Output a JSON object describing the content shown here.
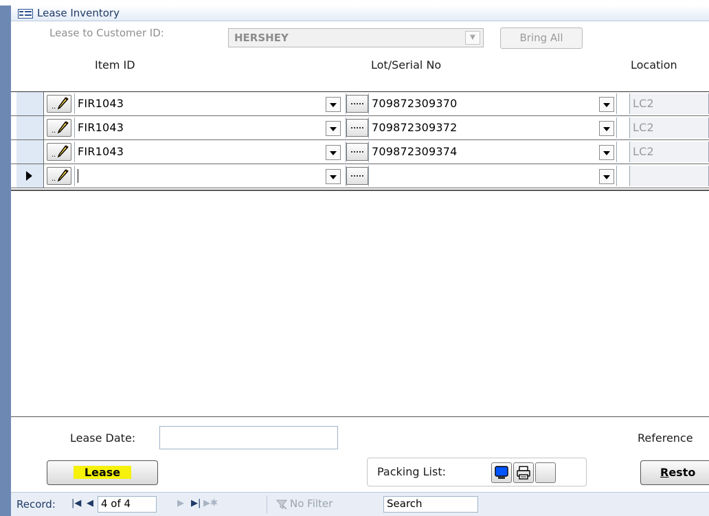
{
  "window": {
    "title": "Lease Inventory"
  },
  "header": {
    "customer_label": "Lease to Customer ID:",
    "customer_value": "HERSHEY",
    "bring_all_label": "Bring All"
  },
  "columns": {
    "item_id": "Item ID",
    "lot_serial": "Lot/Serial No",
    "location": "Location"
  },
  "rows": [
    {
      "item_id": "FIR1043",
      "lot_serial": "709872309370",
      "location": "LC2"
    },
    {
      "item_id": "FIR1043",
      "lot_serial": "709872309372",
      "location": "LC2"
    },
    {
      "item_id": "FIR1043",
      "lot_serial": "709872309374",
      "location": "LC2"
    },
    {
      "item_id": "",
      "lot_serial": "",
      "location": ""
    }
  ],
  "footer": {
    "lease_date_label": "Lease Date:",
    "lease_date_value": "",
    "reference_label": "Reference",
    "lease_button": "Lease",
    "packing_list_label": "Packing List:",
    "restore_first": "R",
    "restore_rest": "esto"
  },
  "navigation": {
    "record_label": "Record:",
    "position": "4 of 4",
    "filter_label": "No Filter",
    "search_label": "Search"
  },
  "colors": {
    "accent": "#6d89b3",
    "highlight": "#f5f10a",
    "screen_icon": "#0055ff"
  },
  "icons": {
    "title": "form-icon",
    "row_edit": "pencil-icon",
    "packing_screen": "screen-icon",
    "packing_print": "printer-icon",
    "filter": "filter-icon"
  }
}
